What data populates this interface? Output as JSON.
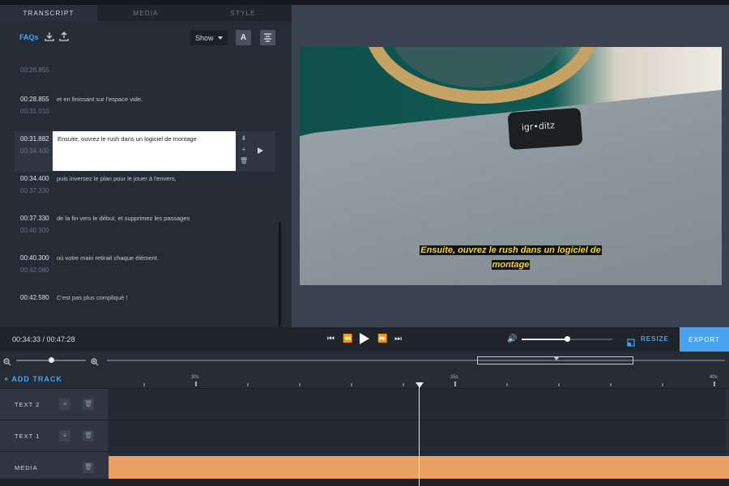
{
  "tabs": [
    {
      "label": "TRANSCRIPT"
    },
    {
      "label": "MEDIA"
    },
    {
      "label": "STYLE"
    }
  ],
  "toolbar": {
    "faqs_label": "FAQs",
    "show_label": "Show",
    "font_button": "A"
  },
  "transcript": {
    "rows": [
      {
        "start": "",
        "end": "00:28.855",
        "text": ""
      },
      {
        "start": "00:28.855",
        "end": "00:31.010",
        "text": "et en finissant sur l'espace vide."
      },
      {
        "start": "00:31.882",
        "end": "00:34.400",
        "text": "Ensuite, ouvrez le rush dans un logiciel de montage"
      },
      {
        "start": "00:34.400",
        "end": "00:37.330",
        "text": "puis inversez le plan pour le jouer à l'envers,"
      },
      {
        "start": "00:37.330",
        "end": "00:40.300",
        "text": "de la fin vers le début, et supprimez les passages"
      },
      {
        "start": "00:40.300",
        "end": "00:42.080",
        "text": "où votre main retirait chaque élément."
      },
      {
        "start": "00:42.580",
        "end": "",
        "text": "C'est pas plus compliqué !"
      }
    ]
  },
  "preview": {
    "device_text": "igr•ditz",
    "subtitle_line1": "Ensuite, ouvrez le rush dans un logiciel de",
    "subtitle_line2": "montage"
  },
  "player": {
    "timecode": "00:34:33 / 00:47:28",
    "volume_level": 0.5,
    "resize_label": "RESIZE",
    "export_label": "EXPORT"
  },
  "timeline": {
    "add_track_label": "+ ADD TRACK",
    "ticks": [
      "30s",
      "35s",
      "40s"
    ],
    "tracks": [
      {
        "label": "TEXT 2"
      },
      {
        "label": "TEXT 1"
      },
      {
        "label": "MEDIA"
      }
    ]
  },
  "colors": {
    "accent": "#4aa3f0",
    "media_clip": "#e8a064",
    "subtitle": "#f4d23c"
  }
}
